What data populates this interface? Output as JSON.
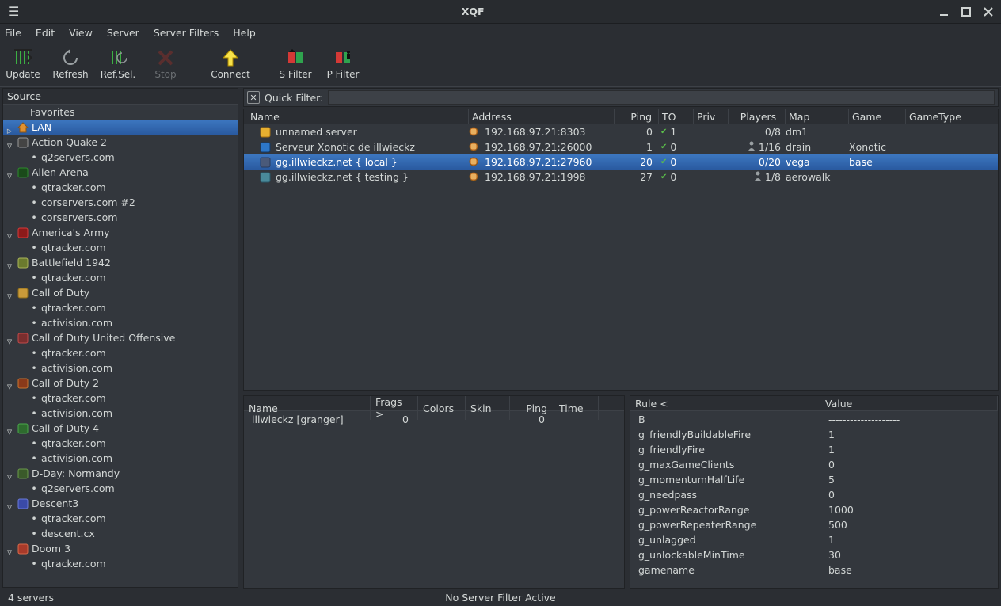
{
  "window": {
    "title": "XQF"
  },
  "menu": [
    "File",
    "Edit",
    "View",
    "Server",
    "Server Filters",
    "Help"
  ],
  "toolbar": {
    "update": "Update",
    "refresh": "Refresh",
    "refsel": "Ref.Sel.",
    "stop": "Stop",
    "connect": "Connect",
    "sfilter": "S Filter",
    "pfilter": "P Filter"
  },
  "source": {
    "header": "Source",
    "tree": [
      {
        "depth": 1,
        "disc": "",
        "icon": "",
        "label": "Favorites"
      },
      {
        "depth": 0,
        "disc": "▹",
        "icon": "home",
        "label": "LAN",
        "selected": true
      },
      {
        "depth": 0,
        "disc": "▿",
        "icon": "aq2",
        "label": "Action Quake 2"
      },
      {
        "depth": 2,
        "bullet": true,
        "label": "q2servers.com"
      },
      {
        "depth": 0,
        "disc": "▿",
        "icon": "alien",
        "label": "Alien Arena"
      },
      {
        "depth": 2,
        "bullet": true,
        "label": "qtracker.com"
      },
      {
        "depth": 2,
        "bullet": true,
        "label": "corservers.com #2"
      },
      {
        "depth": 2,
        "bullet": true,
        "label": "corservers.com"
      },
      {
        "depth": 0,
        "disc": "▿",
        "icon": "army",
        "label": "America's Army"
      },
      {
        "depth": 2,
        "bullet": true,
        "label": "qtracker.com"
      },
      {
        "depth": 0,
        "disc": "▿",
        "icon": "bf42",
        "label": "Battlefield 1942"
      },
      {
        "depth": 2,
        "bullet": true,
        "label": "qtracker.com"
      },
      {
        "depth": 0,
        "disc": "▿",
        "icon": "cod",
        "label": "Call of Duty"
      },
      {
        "depth": 2,
        "bullet": true,
        "label": "qtracker.com"
      },
      {
        "depth": 2,
        "bullet": true,
        "label": "activision.com"
      },
      {
        "depth": 0,
        "disc": "▿",
        "icon": "coduo",
        "label": "Call of Duty United Offensive"
      },
      {
        "depth": 2,
        "bullet": true,
        "label": "qtracker.com"
      },
      {
        "depth": 2,
        "bullet": true,
        "label": "activision.com"
      },
      {
        "depth": 0,
        "disc": "▿",
        "icon": "cod2",
        "label": "Call of Duty 2"
      },
      {
        "depth": 2,
        "bullet": true,
        "label": "qtracker.com"
      },
      {
        "depth": 2,
        "bullet": true,
        "label": "activision.com"
      },
      {
        "depth": 0,
        "disc": "▿",
        "icon": "cod4",
        "label": "Call of Duty 4"
      },
      {
        "depth": 2,
        "bullet": true,
        "label": "qtracker.com"
      },
      {
        "depth": 2,
        "bullet": true,
        "label": "activision.com"
      },
      {
        "depth": 0,
        "disc": "▿",
        "icon": "dday",
        "label": "D-Day: Normandy"
      },
      {
        "depth": 2,
        "bullet": true,
        "label": "q2servers.com"
      },
      {
        "depth": 0,
        "disc": "▿",
        "icon": "d3",
        "label": "Descent3"
      },
      {
        "depth": 2,
        "bullet": true,
        "label": "qtracker.com"
      },
      {
        "depth": 2,
        "bullet": true,
        "label": "descent.cx"
      },
      {
        "depth": 0,
        "disc": "▿",
        "icon": "doom3",
        "label": "Doom 3"
      },
      {
        "depth": 2,
        "bullet": true,
        "label": "qtracker.com"
      }
    ]
  },
  "quickfilter": {
    "label": "Quick Filter:"
  },
  "srv": {
    "cols": [
      "Name",
      "Address",
      "Ping",
      "TO",
      "Priv",
      "Players",
      "Map",
      "Game",
      "GameType"
    ],
    "rows": [
      {
        "icon": "q3",
        "name": "unnamed server",
        "addr": "192.168.97.21:8303",
        "ping": "0",
        "to": "1",
        "tick": true,
        "picon": "",
        "players": "0/8",
        "map": "dm1",
        "game": "",
        "gt": ""
      },
      {
        "icon": "xon",
        "name": "Serveur Xonotic de illwieckz",
        "addr": "192.168.97.21:26000",
        "ping": "1",
        "to": "0",
        "tick": true,
        "picon": "person",
        "players": "1/16",
        "map": "drain",
        "game": "Xonotic",
        "gt": ""
      },
      {
        "icon": "unv",
        "name": "gg.illwieckz.net { local }",
        "addr": "192.168.97.21:27960",
        "ping": "20",
        "to": "0",
        "tick": true,
        "picon": "",
        "players": "0/20",
        "map": "vega",
        "game": "base",
        "gt": "",
        "selected": true
      },
      {
        "icon": "unv2",
        "name": "gg.illwieckz.net { testing }",
        "addr": "192.168.97.21:1998",
        "ping": "27",
        "to": "0",
        "tick": true,
        "picon": "person",
        "players": "1/8",
        "map": "aerowalk",
        "game": "",
        "gt": ""
      }
    ]
  },
  "players": {
    "cols": [
      "Name",
      "Frags >",
      "Colors",
      "Skin",
      "Ping",
      "Time"
    ],
    "rows": [
      {
        "name": "illwieckz [granger]",
        "frags": "0",
        "colors": "",
        "skin": "",
        "ping": "0",
        "time": ""
      }
    ]
  },
  "rules": {
    "cols": [
      "Rule <",
      "Value"
    ],
    "rows": [
      {
        "rule": "B",
        "value": "--------------------"
      },
      {
        "rule": "g_friendlyBuildableFire",
        "value": "1"
      },
      {
        "rule": "g_friendlyFire",
        "value": "1"
      },
      {
        "rule": "g_maxGameClients",
        "value": "0"
      },
      {
        "rule": "g_momentumHalfLife",
        "value": "5"
      },
      {
        "rule": "g_needpass",
        "value": "0"
      },
      {
        "rule": "g_powerReactorRange",
        "value": "1000"
      },
      {
        "rule": "g_powerRepeaterRange",
        "value": "500"
      },
      {
        "rule": "g_unlagged",
        "value": "1"
      },
      {
        "rule": "g_unlockableMinTime",
        "value": "30"
      },
      {
        "rule": "gamename",
        "value": "base"
      }
    ]
  },
  "status": {
    "left": "4 servers",
    "mid": "No Server Filter Active"
  }
}
